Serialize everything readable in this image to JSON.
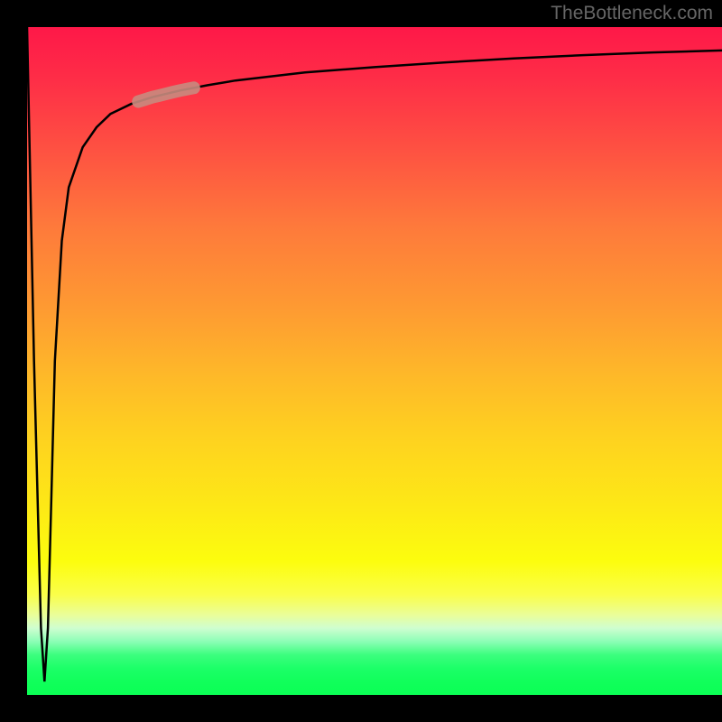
{
  "watermark": "TheBottleneck.com",
  "chart_data": {
    "type": "line",
    "title": "",
    "xlabel": "",
    "ylabel": "",
    "xlim": [
      0,
      100
    ],
    "ylim": [
      0,
      100
    ],
    "curve": {
      "description": "Bottleneck curve - drops from top-left to near-zero very quickly then rises asymptotically toward 100",
      "x": [
        0,
        1,
        2,
        2.5,
        3,
        3.5,
        4,
        5,
        6,
        8,
        10,
        12,
        15,
        18,
        22,
        26,
        30,
        35,
        40,
        50,
        60,
        70,
        80,
        90,
        100
      ],
      "y_percent": [
        100,
        50,
        10,
        2,
        10,
        30,
        50,
        68,
        76,
        82,
        85,
        87,
        88.5,
        89.5,
        90.5,
        91.3,
        92,
        92.6,
        93.2,
        94,
        94.7,
        95.3,
        95.8,
        96.2,
        96.5
      ]
    },
    "highlight": {
      "x_range": [
        16,
        24
      ],
      "color": "#c88b7e",
      "description": "Highlighted segment on curve"
    },
    "background": {
      "type": "vertical-gradient",
      "top_color": "#fe1848",
      "middle_color": "#fcfd0e",
      "bottom_color": "#0aff54"
    }
  }
}
